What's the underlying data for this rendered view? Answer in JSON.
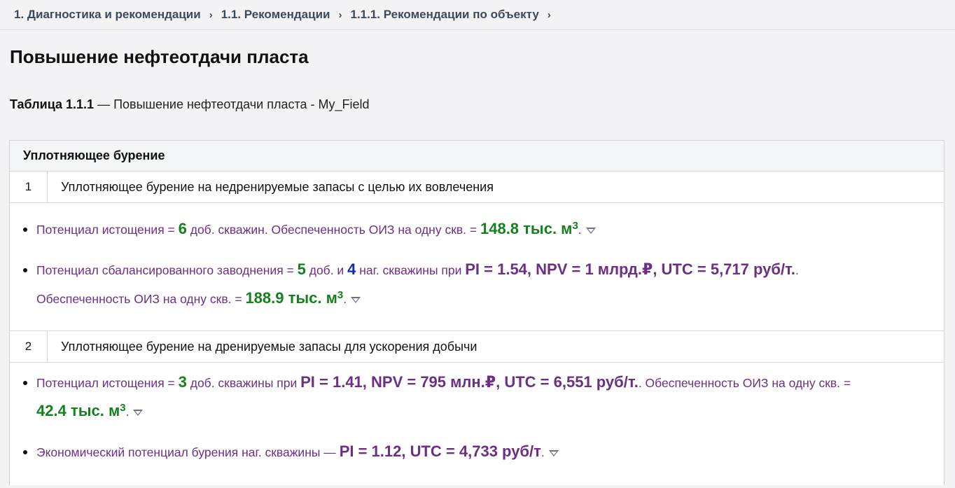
{
  "breadcrumb": {
    "items": [
      "1. Диагностика и рекомендации",
      "1.1. Рекомендации",
      "1.1.1. Рекомендации по объекту"
    ],
    "separator": "›"
  },
  "page_title": "Повышение нефтеотдачи пласта",
  "caption": {
    "label": "Таблица 1.1.1",
    "text": " — Повышение нефтеотдачи пласта - My_Field"
  },
  "section": {
    "title": "Уплотняющее бурение"
  },
  "rows": [
    {
      "number": "1",
      "title": "Уплотняющее бурение на недренируемые запасы с целью их вовлечения",
      "bullets": [
        {
          "t1": "Потенциал истощения = ",
          "v1": "6",
          "t2": " доб. скважин. Обеспеченность ОИЗ на одну скв. = ",
          "v2": "148.8 тыс. м",
          "sup": "3",
          "end": "."
        },
        {
          "t1": "Потенциал сбалансированного заводнения = ",
          "v1": "5",
          "t2": " доб. и ",
          "v2": "4",
          "t3": " наг. скважины при ",
          "v3": "PI = 1.54, NPV = 1 млрд.₽, UTC = 5,717 руб/т.",
          "t4": ".",
          "t5": "Обеспеченность ОИЗ на одну скв. = ",
          "v4": "188.9 тыс. м",
          "sup": "3",
          "end": "."
        }
      ]
    },
    {
      "number": "2",
      "title": "Уплотняющее бурение на дренируемые запасы для ускорения добычи",
      "bullets": [
        {
          "t1": "Потенциал истощения = ",
          "v1": "3",
          "t2": " доб. скважины при ",
          "v2": "PI = 1.41, NPV = 795 млн.₽, UTC = 6,551 руб/т.",
          "t3": ". Обеспеченность ОИЗ на одну скв. = ",
          "v3": "42.4 тыс. м",
          "sup": "3",
          "end": "."
        },
        {
          "t1": "Экономический потенциал бурения наг. скважины — ",
          "v1": "PI = 1.12, UTC = 4,733 руб/т",
          "end": "."
        }
      ]
    }
  ],
  "colors": {
    "accent_text": "#6d2f85",
    "green_value": "#14801e",
    "blue_value": "#1526b0"
  }
}
